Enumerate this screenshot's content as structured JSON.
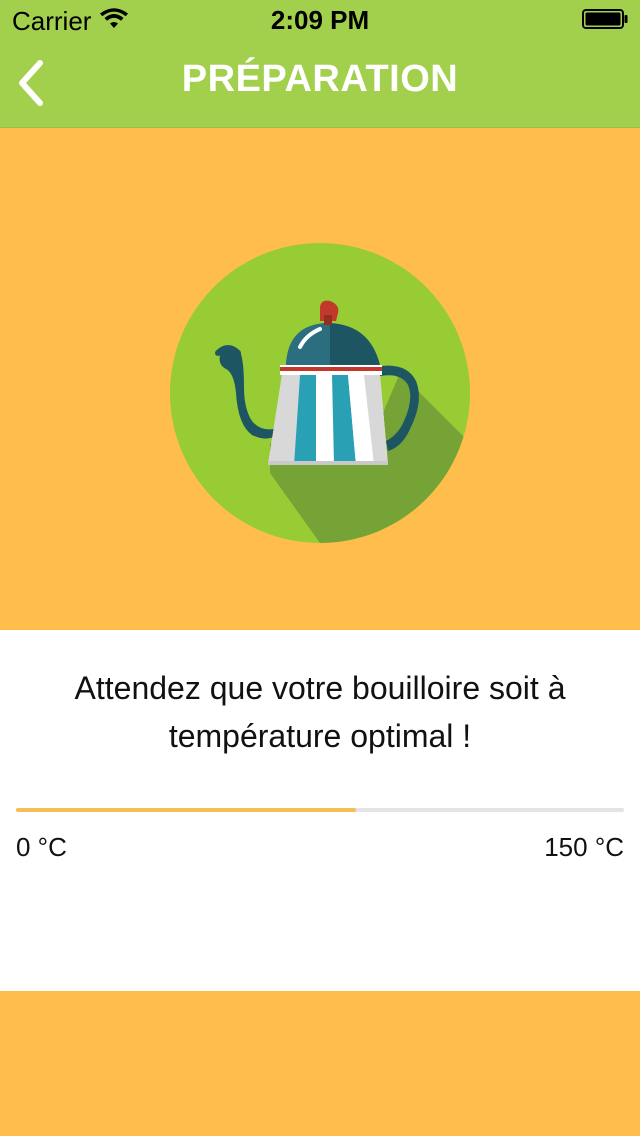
{
  "status_bar": {
    "carrier": "Carrier",
    "time": "2:09 PM"
  },
  "header": {
    "title": "PRÉPARATION",
    "back_icon": "chevron-left-icon"
  },
  "hero": {
    "icon": "kettle-icon"
  },
  "card": {
    "message": "Attendez que votre bouilloire soit à température optimal !",
    "progress_fraction": 0.56,
    "min_label": "0 °C",
    "max_label": "150 °C"
  },
  "colors": {
    "header": "#A2D04D",
    "background": "#FFBE4B",
    "progress": "#F6BE55",
    "circle": "#97CC35"
  }
}
